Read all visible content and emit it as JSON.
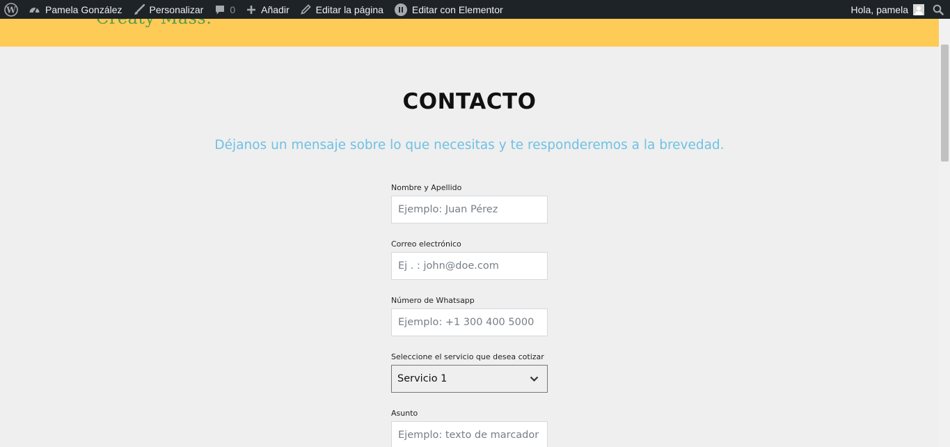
{
  "admin_bar": {
    "site_name": "Pamela González",
    "customize": "Personalizar",
    "comments_count": "0",
    "add_new": "Añadir",
    "edit_page": "Editar la página",
    "edit_elementor": "Editar con Elementor",
    "greeting": "Hola, pamela"
  },
  "header": {
    "logo_text": "Creaty Mass."
  },
  "page": {
    "title": "CONTACTO",
    "subtitle": "Déjanos un mensaje sobre lo que necesitas y te responderemos a la brevedad."
  },
  "form": {
    "name_label": "Nombre y Apellido",
    "name_placeholder": "Ejemplo: Juan Pérez",
    "email_label": "Correo electrónico",
    "email_placeholder": "Ej . : john@doe.com",
    "whatsapp_label": "Número de Whatsapp",
    "whatsapp_placeholder": "Ejemplo: +1 300 400 5000",
    "service_label": "Seleccione el servicio que desea cotizar",
    "service_selected": "Servicio 1",
    "subject_label": "Asunto",
    "subject_placeholder": "Ejemplo: texto de marcador"
  },
  "colors": {
    "admin_bar_bg": "#1d2327",
    "header_bg": "#ffcb57",
    "page_bg": "#efefef",
    "subtitle": "#6ec1e4"
  },
  "icons": [
    "wordpress-icon",
    "dashboard-icon",
    "brush-icon",
    "comment-icon",
    "plus-icon",
    "pencil-icon",
    "elementor-icon",
    "avatar",
    "search-icon",
    "chevron-down-icon"
  ]
}
